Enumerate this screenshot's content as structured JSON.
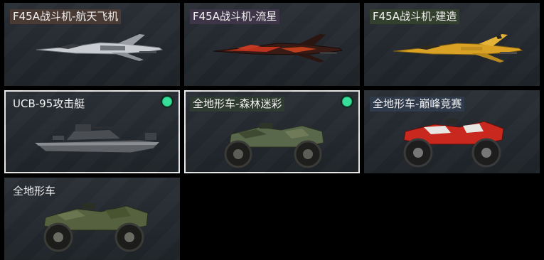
{
  "cards": [
    {
      "label": "F45A战斗机-航天飞机",
      "selected": false,
      "equipped": false,
      "label_bg": "#4a3a34",
      "icon": "jet-white-icon"
    },
    {
      "label": "F45A战斗机-流星",
      "selected": false,
      "equipped": false,
      "label_bg": "#3e3648",
      "icon": "jet-red-icon"
    },
    {
      "label": "F45A战斗机-建造",
      "selected": false,
      "equipped": false,
      "label_bg": "#34402e",
      "icon": "jet-yellow-icon"
    },
    {
      "label": "UCB-95攻击艇",
      "selected": true,
      "equipped": true,
      "label_bg": "transparent",
      "icon": "boat-icon"
    },
    {
      "label": "全地形车-森林迷彩",
      "selected": true,
      "equipped": true,
      "label_bg": "#2f3a30",
      "icon": "atv-camo-icon"
    },
    {
      "label": "全地形车-巅峰竞赛",
      "selected": false,
      "equipped": false,
      "label_bg": "#2f3a4a",
      "icon": "atv-red-icon"
    },
    {
      "label": "全地形车",
      "selected": false,
      "equipped": false,
      "label_bg": "transparent",
      "icon": "atv-green-icon"
    }
  ],
  "colors": {
    "jet_white": "#c9ccd0",
    "jet_red": "#b8321c",
    "jet_yellow": "#d9a224",
    "boat": "#5e6266",
    "atv_camo": "#59684a",
    "atv_red": "#c8281e",
    "atv_green": "#55613f",
    "badge": "#37e09a"
  }
}
